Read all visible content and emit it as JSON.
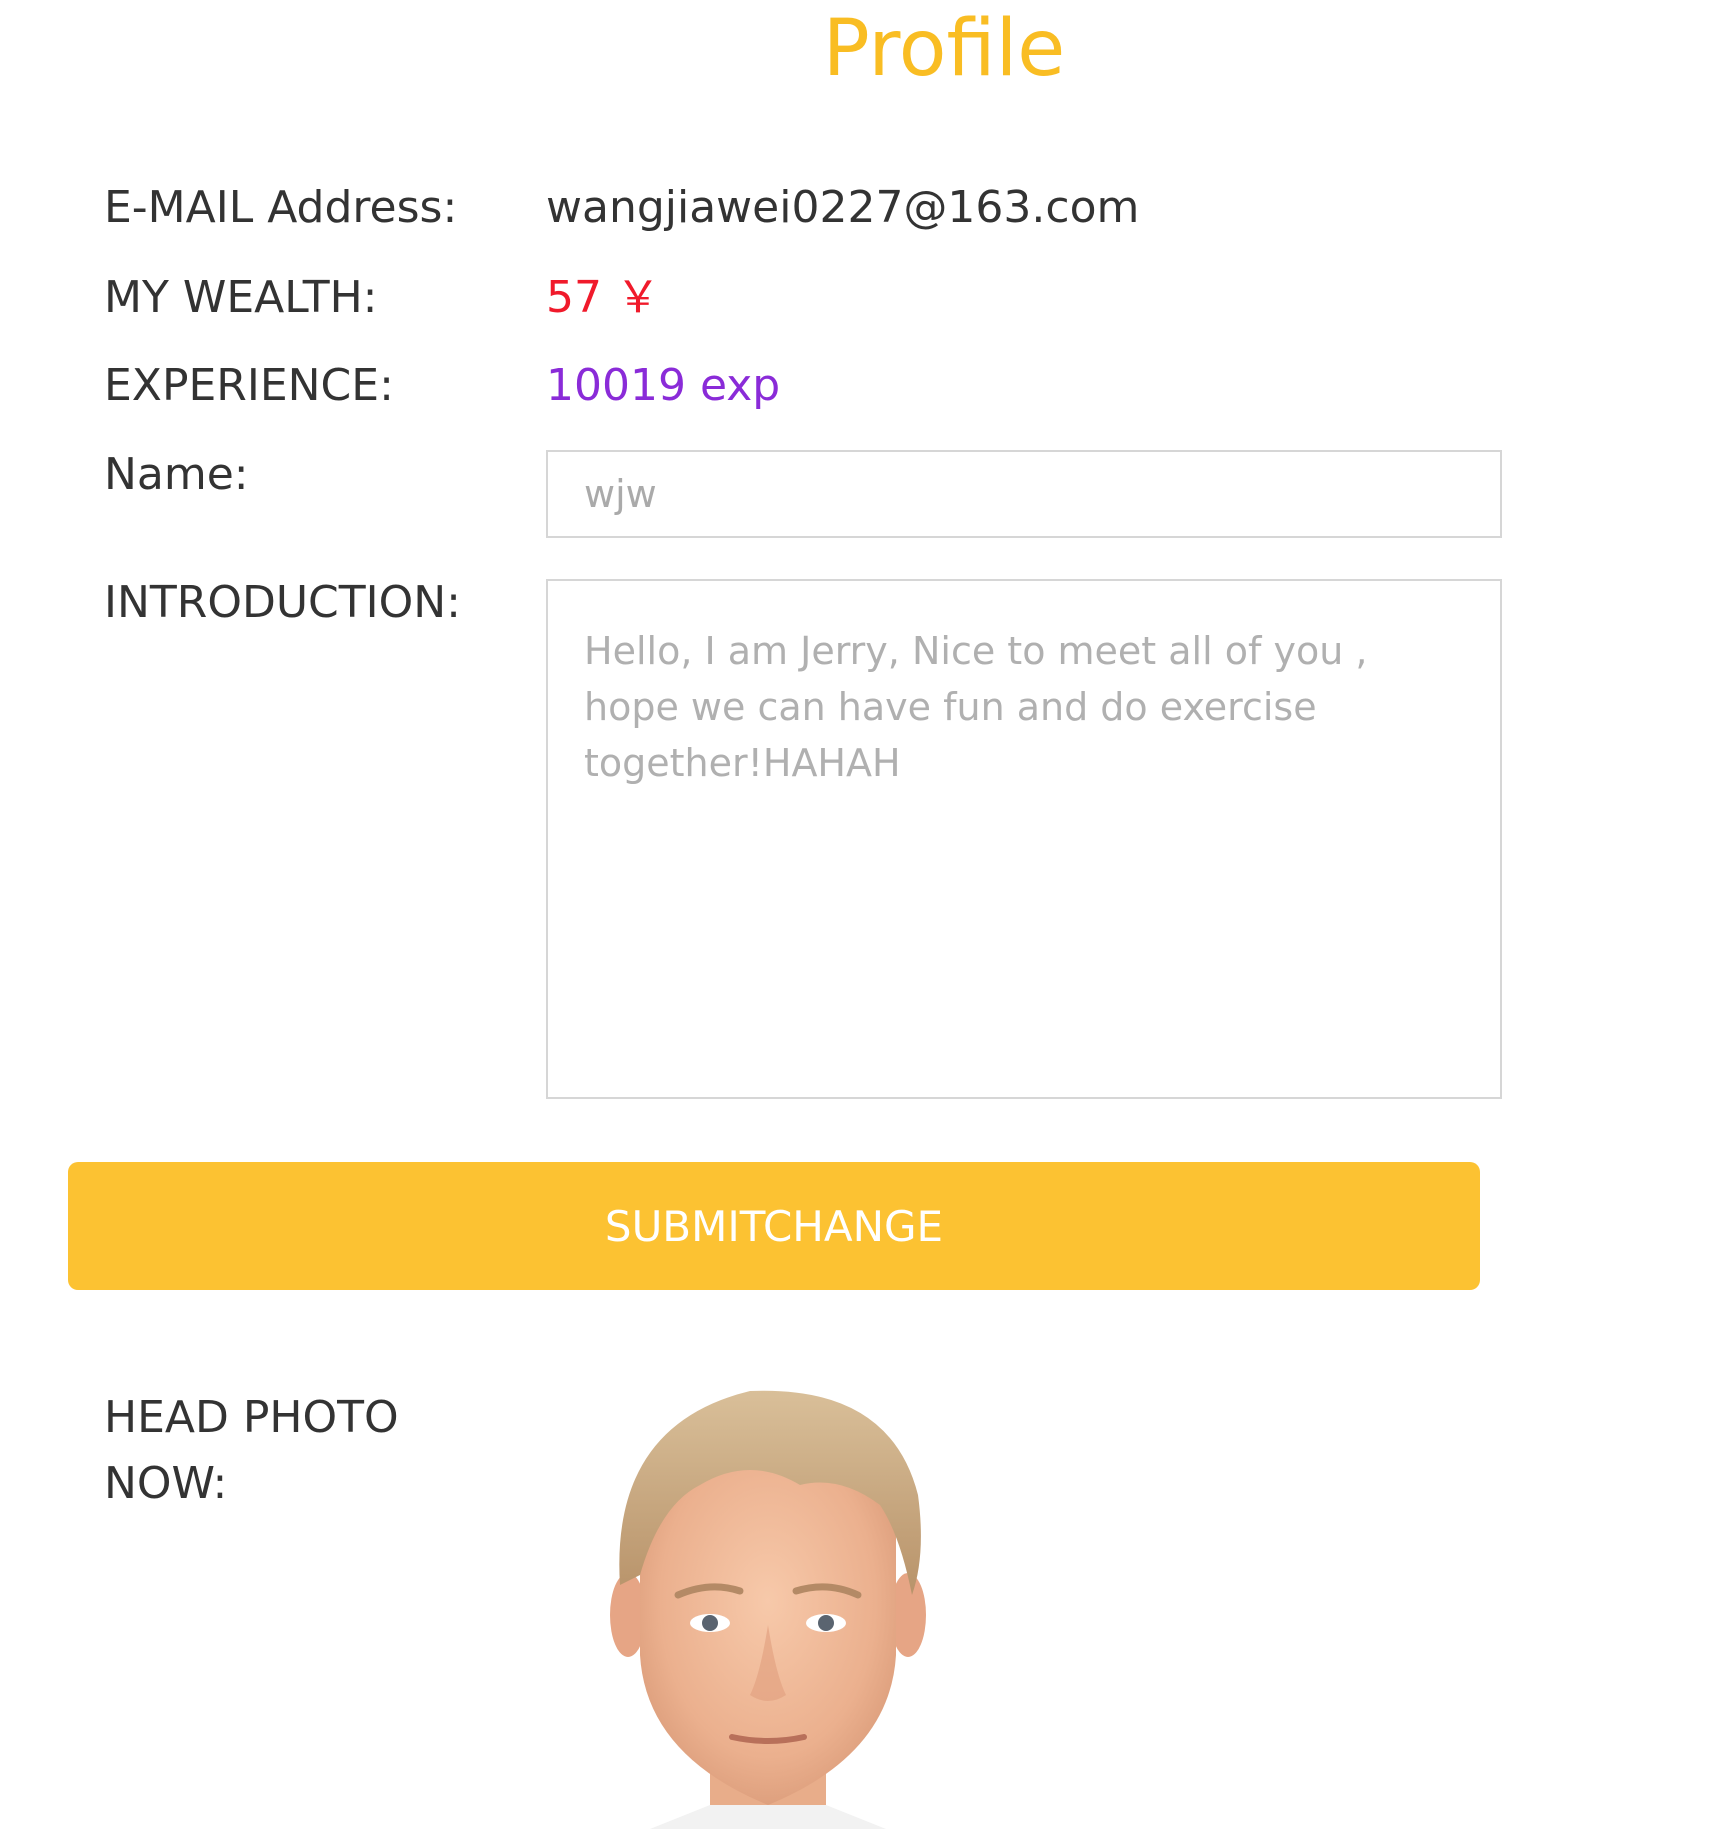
{
  "page": {
    "title": "Profile"
  },
  "profile": {
    "email_label": "E-MAIL Address:",
    "email_value": "wangjiawei0227@163.com",
    "wealth_label": "MY WEALTH:",
    "wealth_value": "57 ￥",
    "experience_label": "EXPERIENCE:",
    "experience_value": "10019 exp",
    "name_label": "Name:",
    "name_placeholder": "wjw",
    "introduction_label": "INTRODUCTION:",
    "introduction_placeholder": "Hello, I am Jerry, Nice to meet all of you , hope we can have fun and do exercise together!HAHAH",
    "submit_label": "SUBMITCHANGE",
    "head_photo_label": "HEAD PHOTO NOW:"
  },
  "colors": {
    "accent": "#f9bd23",
    "button": "#fcc232",
    "wealth": "#f01a2b",
    "experience": "#8a2bd8",
    "text": "#333333",
    "placeholder": "#aaaaaa",
    "border": "#d6d6d6"
  }
}
